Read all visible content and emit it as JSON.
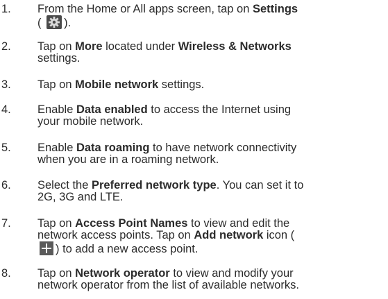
{
  "steps": [
    {
      "num": "1.",
      "lines": [
        [
          {
            "t": "From the Home or All apps screen, tap on "
          },
          {
            "t": "Settings",
            "b": true
          }
        ],
        [
          {
            "t": "( "
          },
          {
            "icon": "settings-gear-icon"
          },
          {
            "t": ")."
          }
        ]
      ]
    },
    {
      "num": "2.",
      "lines": [
        [
          {
            "t": "Tap on "
          },
          {
            "t": "More",
            "b": true
          },
          {
            "t": " located under "
          },
          {
            "t": "Wireless & Networks",
            "b": true
          }
        ],
        [
          {
            "t": "settings."
          }
        ]
      ]
    },
    {
      "num": "3.",
      "lines": [
        [
          {
            "t": "Tap on "
          },
          {
            "t": "Mobile network",
            "b": true
          },
          {
            "t": " settings."
          }
        ]
      ]
    },
    {
      "num": "4.",
      "lines": [
        [
          {
            "t": "Enable "
          },
          {
            "t": "Data enabled",
            "b": true
          },
          {
            "t": " to access the Internet using"
          }
        ],
        [
          {
            "t": "your mobile network."
          }
        ]
      ]
    },
    {
      "num": "5.",
      "lines": [
        [
          {
            "t": "Enable "
          },
          {
            "t": "Data roaming",
            "b": true
          },
          {
            "t": " to have network connectivity"
          }
        ],
        [
          {
            "t": "when you are in a roaming network."
          }
        ]
      ]
    },
    {
      "num": "6.",
      "lines": [
        [
          {
            "t": "Select the "
          },
          {
            "t": "Preferred network type",
            "b": true
          },
          {
            "t": ". You can set it to"
          }
        ],
        [
          {
            "t": "2G, 3G and LTE."
          }
        ]
      ]
    },
    {
      "num": "7.",
      "lines": [
        [
          {
            "t": "Tap on "
          },
          {
            "t": "Access Point Names",
            "b": true
          },
          {
            "t": " to view and edit the"
          }
        ],
        [
          {
            "t": "network access points. Tap on "
          },
          {
            "t": "Add network",
            "b": true
          },
          {
            "t": " icon ("
          }
        ],
        [
          {
            "icon": "add-network-icon"
          },
          {
            "t": ") to add a new access point."
          }
        ]
      ]
    },
    {
      "num": "8.",
      "lines": [
        [
          {
            "t": "Tap on "
          },
          {
            "t": "Network operator",
            "b": true
          },
          {
            "t": " to view and modify your"
          }
        ],
        [
          {
            "t": "network operator from the list of available networks."
          }
        ]
      ]
    }
  ]
}
